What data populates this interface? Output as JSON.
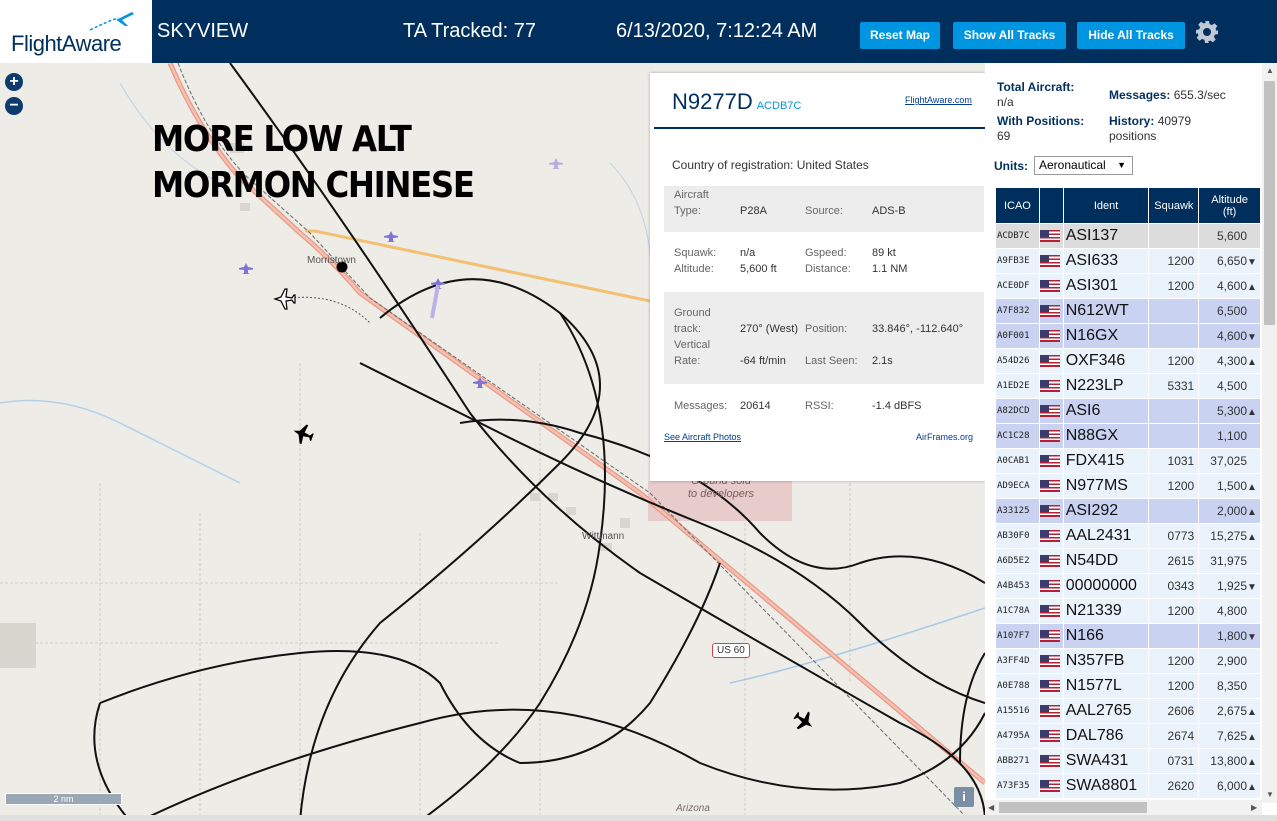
{
  "header": {
    "logo_text": "FlightAware",
    "app_name": "SKYVIEW",
    "tracked": "TA Tracked: 77",
    "datetime": "6/13/2020, 7:12:24 AM",
    "buttons": {
      "reset": "Reset Map",
      "show": "Show All Tracks",
      "hide": "Hide All Tracks"
    }
  },
  "map": {
    "zoom_in": "+",
    "zoom_out": "−",
    "overlay_line1": "MORE LOW ALT",
    "overlay_line2": "MORMON CHINESE",
    "labels": {
      "morristown": "Morristown",
      "wittmann": "Wittmann",
      "arizona": "Arizona",
      "ground": "Ground sold to developers",
      "us60": "US 60"
    },
    "scale": "2 nm",
    "info": "i"
  },
  "selected_plane": {
    "callsign": "N9277D",
    "hex": "ACDB7C",
    "link": "FlightAware.com",
    "country_label": "Country of registration:",
    "country": "United States",
    "aircraft_type_label_1": "Aircraft",
    "aircraft_type_label_2": "Type:",
    "aircraft_type": "P28A",
    "source_label": "Source:",
    "source": "ADS-B",
    "squawk_label": "Squawk:",
    "squawk": "n/a",
    "gspeed_label": "Gspeed:",
    "gspeed": "89 kt",
    "altitude_label": "Altitude:",
    "altitude": "5,600 ft",
    "distance_label": "Distance:",
    "distance": "1.1 NM",
    "track_label_1": "Ground",
    "track_label_2": "track:",
    "track": "270° (West)",
    "position_label": "Position:",
    "position": "33.846°, -112.640°",
    "vrate_label_1": "Vertical",
    "vrate_label_2": "Rate:",
    "vrate": "-64 ft/min",
    "lastseen_label": "Last Seen:",
    "lastseen": "2.1s",
    "messages_label": "Messages:",
    "messages": "20614",
    "rssi_label": "RSSI:",
    "rssi": "-1.4 dBFS",
    "photos_link": "See Aircraft Photos",
    "airframes_link": "AirFrames.org"
  },
  "sidebar": {
    "total_label": "Total Aircraft:",
    "total": "n/a",
    "messages_label": "Messages:",
    "messages": "655.3/sec",
    "positions_label": "With Positions:",
    "positions": "69",
    "history_label": "History:",
    "history_1": "40979",
    "history_2": "positions",
    "units_label": "Units:",
    "units_value": "Aeronautical",
    "columns": {
      "icao": "ICAO",
      "ident": "Ident",
      "squawk": "Squawk",
      "altitude_1": "Altitude",
      "altitude_2": "(ft)"
    }
  },
  "aircraft": [
    {
      "icao": "ACDB7C",
      "ident": "ASI137",
      "squawk": "",
      "alt": "5,600",
      "trend": "",
      "style": "sel"
    },
    {
      "icao": "A9FB3E",
      "ident": "ASI633",
      "squawk": "1200",
      "alt": "6,650",
      "trend": "▼",
      "style": "even"
    },
    {
      "icao": "ACE0DF",
      "ident": "ASI301",
      "squawk": "1200",
      "alt": "4,600",
      "trend": "▲",
      "style": "even"
    },
    {
      "icao": "A7F832",
      "ident": "N612WT",
      "squawk": "",
      "alt": "6,500",
      "trend": "",
      "style": "pos"
    },
    {
      "icao": "A0F001",
      "ident": "N16GX",
      "squawk": "",
      "alt": "4,600",
      "trend": "▼",
      "style": "pos"
    },
    {
      "icao": "A54D26",
      "ident": "OXF346",
      "squawk": "1200",
      "alt": "4,300",
      "trend": "▲",
      "style": "even"
    },
    {
      "icao": "A1ED2E",
      "ident": "N223LP",
      "squawk": "5331",
      "alt": "4,500",
      "trend": "",
      "style": "even"
    },
    {
      "icao": "A82DCD",
      "ident": "ASI6",
      "squawk": "",
      "alt": "5,300",
      "trend": "▲",
      "style": "pos"
    },
    {
      "icao": "AC1C28",
      "ident": "N88GX",
      "squawk": "",
      "alt": "1,100",
      "trend": "",
      "style": "pos"
    },
    {
      "icao": "A0CAB1",
      "ident": "FDX415",
      "squawk": "1031",
      "alt": "37,025",
      "trend": "",
      "style": "even"
    },
    {
      "icao": "AD9ECA",
      "ident": "N977MS",
      "squawk": "1200",
      "alt": "1,500",
      "trend": "▲",
      "style": "even"
    },
    {
      "icao": "A33125",
      "ident": "ASI292",
      "squawk": "",
      "alt": "2,000",
      "trend": "▲",
      "style": "pos"
    },
    {
      "icao": "AB30F0",
      "ident": "AAL2431",
      "squawk": "0773",
      "alt": "15,275",
      "trend": "▲",
      "style": "even"
    },
    {
      "icao": "A6D5E2",
      "ident": "N54DD",
      "squawk": "2615",
      "alt": "31,975",
      "trend": "",
      "style": "even"
    },
    {
      "icao": "A4B453",
      "ident": "00000000",
      "squawk": "0343",
      "alt": "1,925",
      "trend": "▼",
      "style": "even"
    },
    {
      "icao": "A1C78A",
      "ident": "N21339",
      "squawk": "1200",
      "alt": "4,800",
      "trend": "",
      "style": "even"
    },
    {
      "icao": "A107F7",
      "ident": "N166",
      "squawk": "",
      "alt": "1,800",
      "trend": "▼",
      "style": "pos"
    },
    {
      "icao": "A3FF4D",
      "ident": "N357FB",
      "squawk": "1200",
      "alt": "2,900",
      "trend": "",
      "style": "even"
    },
    {
      "icao": "A0E788",
      "ident": "N1577L",
      "squawk": "1200",
      "alt": "8,350",
      "trend": "",
      "style": "even"
    },
    {
      "icao": "A15516",
      "ident": "AAL2765",
      "squawk": "2606",
      "alt": "2,675",
      "trend": "▲",
      "style": "even"
    },
    {
      "icao": "A4795A",
      "ident": "DAL786",
      "squawk": "2674",
      "alt": "7,625",
      "trend": "▲",
      "style": "even"
    },
    {
      "icao": "ABB271",
      "ident": "SWA431",
      "squawk": "0731",
      "alt": "13,800",
      "trend": "▲",
      "style": "even"
    },
    {
      "icao": "A73F35",
      "ident": "SWA8801",
      "squawk": "2620",
      "alt": "6,000",
      "trend": "▲",
      "style": "even"
    }
  ]
}
